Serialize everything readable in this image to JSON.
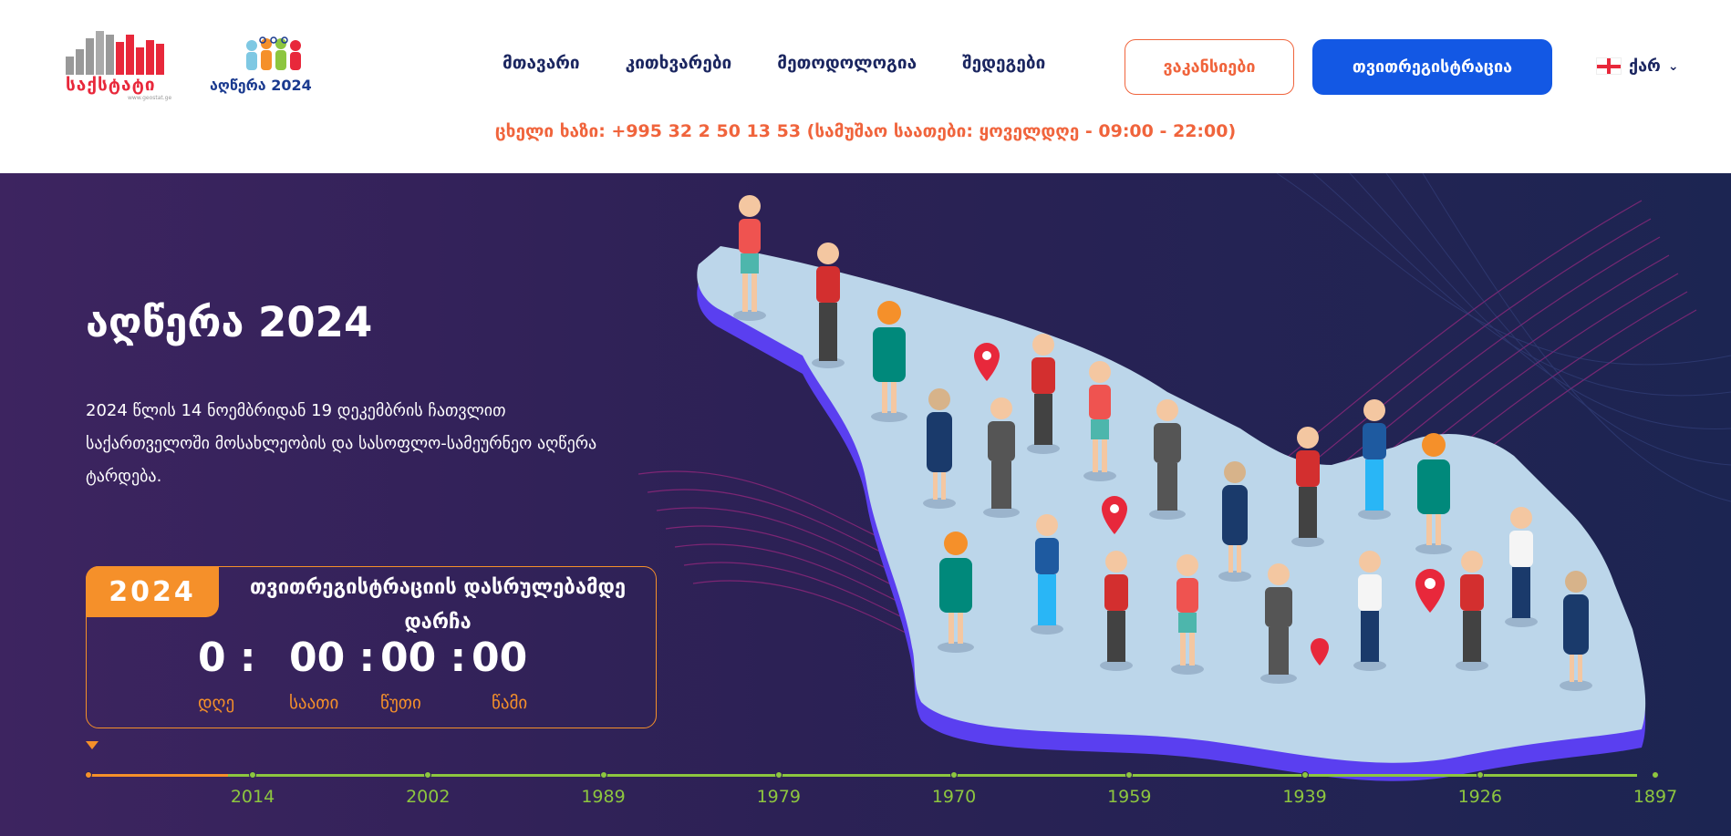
{
  "header": {
    "logo_stat_text": "საქსტატი",
    "logo_stat_sub": "www.geostat.ge",
    "logo_census_text": "აღწერა 2024",
    "nav": [
      {
        "label": "მთავარი"
      },
      {
        "label": "კითხვარები"
      },
      {
        "label": "მეთოდოლოგია"
      },
      {
        "label": "შედეგები"
      }
    ],
    "vacancies_label": "ვაკანსიები",
    "register_label": "თვითრეგისტრაცია",
    "language": "ქარ",
    "hotline": "ცხელი ხაზი: +995 32 2 50 13 53  (სამუშაო საათები: ყოველდღე - 09:00 - 22:00)"
  },
  "hero": {
    "title": "აღწერა 2024",
    "description": "2024 წლის 14 ნოემბრიდან 19 დეკემბრის ჩათვლით საქართველოში მოსახლეობის და სასოფლო-სამეურნეო აღწერა ტარდება.",
    "countdown": {
      "year": "2024",
      "title": "თვითრეგისტრაციის დასრულებამდე დარჩა",
      "days": "0 :",
      "hours": "00 :",
      "minutes": "00 :",
      "seconds": "00",
      "days_label": "დღე",
      "hours_label": "საათი",
      "minutes_label": "წუთი",
      "seconds_label": "წამი"
    },
    "timeline": {
      "years": [
        "2014",
        "2002",
        "1989",
        "1979",
        "1970",
        "1959",
        "1939",
        "1926",
        "1897"
      ],
      "progress": 0.09
    }
  },
  "colors": {
    "accent_orange": "#f5902a",
    "brand_blue": "#1358e4",
    "timeline_green": "#8dc63f",
    "hotline_orange": "#f0643c",
    "map_fill": "#bcd6ea",
    "map_edge": "#5a3ff0",
    "pin_red": "#e8283b"
  }
}
